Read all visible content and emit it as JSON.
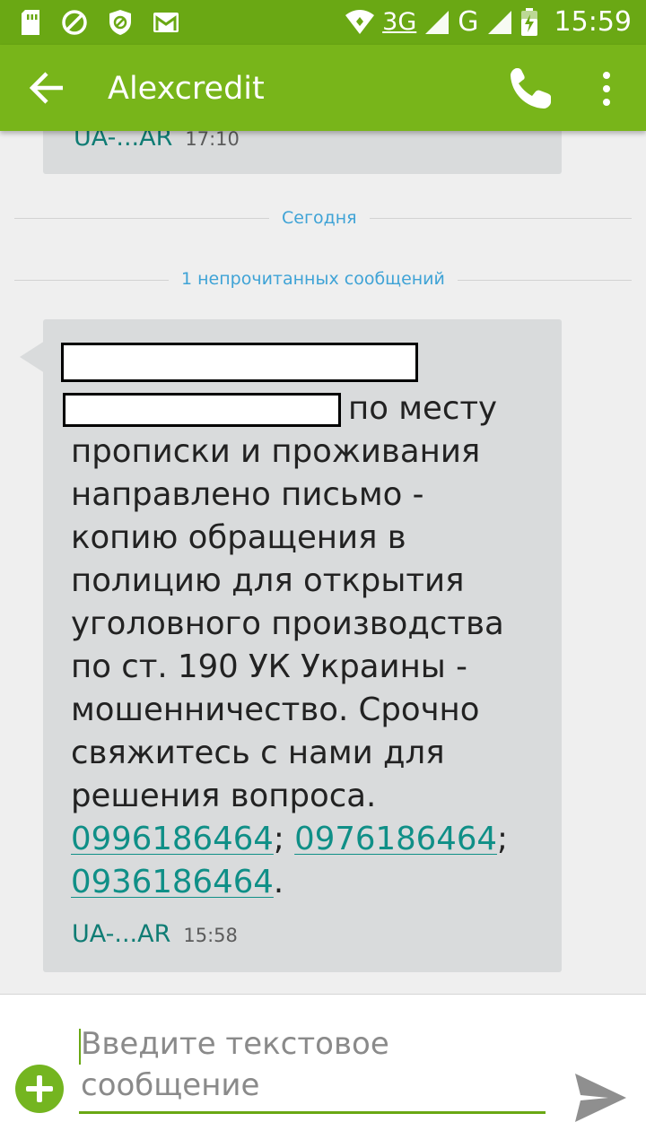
{
  "status_bar": {
    "network_primary": "3G",
    "network_secondary": "G",
    "time": "15:59",
    "icons": [
      "sim-icon",
      "blocked-icon",
      "shield-icon",
      "gmail-icon",
      "wifi-icon",
      "signal-icon",
      "battery-charging-icon"
    ]
  },
  "app_bar": {
    "title": "Alexcredit",
    "icons": [
      "back-arrow-icon",
      "phone-icon",
      "more-vert-icon"
    ],
    "color": "#78b51a"
  },
  "conversation": {
    "previous_message": {
      "sender": "UA-...AR",
      "time": "17:10"
    },
    "date_divider": "Сегодня",
    "unread_divider": "1 непрочитанных сообщений",
    "message": {
      "first_line_tail": "по месту",
      "lines": [
        "прописки и проживания",
        "направлено письмо -",
        "копию обращения в",
        "полицию для открытия",
        "уголовного производства",
        "по ст. 190 УК Украины -",
        "мошенничество. Срочно",
        "свяжитесь с нами для",
        "решения вопроса."
      ],
      "phones": [
        "0996186464",
        "0976186464",
        "0936186464"
      ],
      "separator": ";",
      "terminator": ".",
      "sender": "UA-...AR",
      "time": "15:58",
      "redacted_blocks": 2
    }
  },
  "composer": {
    "placeholder": "Введите текстовое\nсообщение",
    "icons": [
      "add-icon",
      "send-icon"
    ]
  }
}
